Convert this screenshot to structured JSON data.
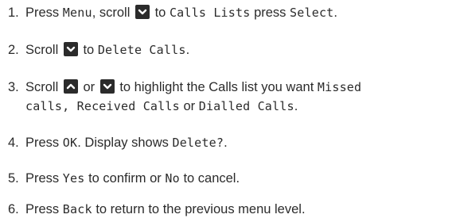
{
  "steps": [
    {
      "num": "1.",
      "parts": [
        "Press",
        "Menu",
        ", scroll",
        "to",
        "Calls Lists",
        "press",
        "Select",
        "."
      ]
    },
    {
      "num": "2.",
      "parts": [
        "Scroll",
        "to",
        "Delete Calls",
        "."
      ]
    },
    {
      "num": "3.",
      "parts": [
        "Scroll",
        "or",
        "to highlight the Calls list you want",
        "Missed",
        "calls, Received Calls",
        "or",
        "Dialled Calls",
        "."
      ]
    },
    {
      "num": "4.",
      "parts": [
        "Press",
        "OK",
        ". Display shows",
        "Delete?",
        "."
      ]
    },
    {
      "num": "5.",
      "parts": [
        "Press",
        "Yes",
        "to confirm or",
        "No",
        "to cancel."
      ]
    },
    {
      "num": "6.",
      "parts": [
        "Press",
        "Back",
        "to return to the previous menu level."
      ]
    }
  ],
  "icons": {
    "down": "chevron-down-icon",
    "up": "chevron-up-icon"
  },
  "colors": {
    "text": "#2b2b2b",
    "key_bg": "#2b2b2b",
    "key_fg": "#ffffff"
  }
}
